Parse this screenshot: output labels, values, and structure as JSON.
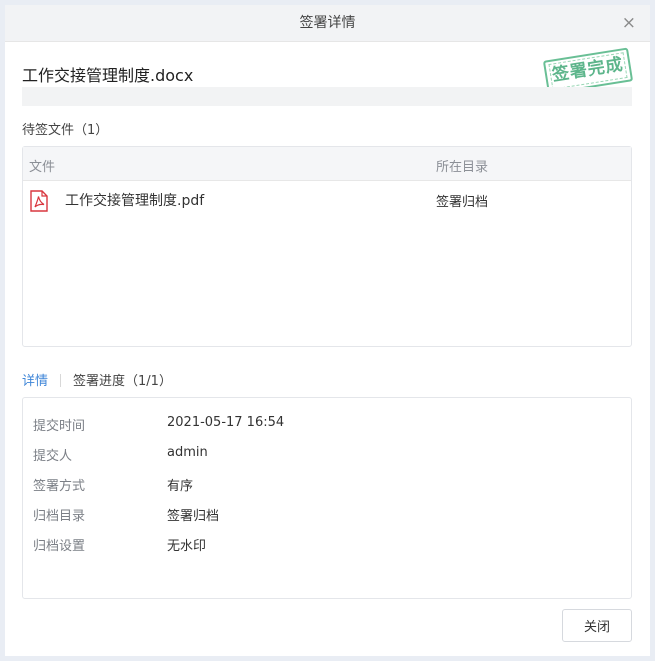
{
  "dialog": {
    "title": "签署详情",
    "close_symbol": "×"
  },
  "document": {
    "name": "工作交接管理制度.docx",
    "stamp": "签署完成",
    "stamp_color": "#4cae7f"
  },
  "pending_files": {
    "label": "待签文件（1）",
    "columns": {
      "file": "文件",
      "directory": "所在目录"
    },
    "rows": [
      {
        "icon": "pdf-icon",
        "name": "工作交接管理制度.pdf",
        "directory": "签署归档"
      }
    ]
  },
  "tabs": [
    {
      "label": "详情",
      "active": true
    },
    {
      "label": "签署进度（1/1）",
      "active": false
    }
  ],
  "details": [
    {
      "key": "提交时间",
      "value": "2021-05-17 16:54"
    },
    {
      "key": "提交人",
      "value": "admin"
    },
    {
      "key": "签署方式",
      "value": "有序"
    },
    {
      "key": "归档目录",
      "value": "签署归档"
    },
    {
      "key": "归档设置",
      "value": "无水印"
    }
  ],
  "footer": {
    "close_label": "关闭"
  },
  "colors": {
    "accent": "#3f86d8",
    "pdf_red": "#d9363e"
  }
}
